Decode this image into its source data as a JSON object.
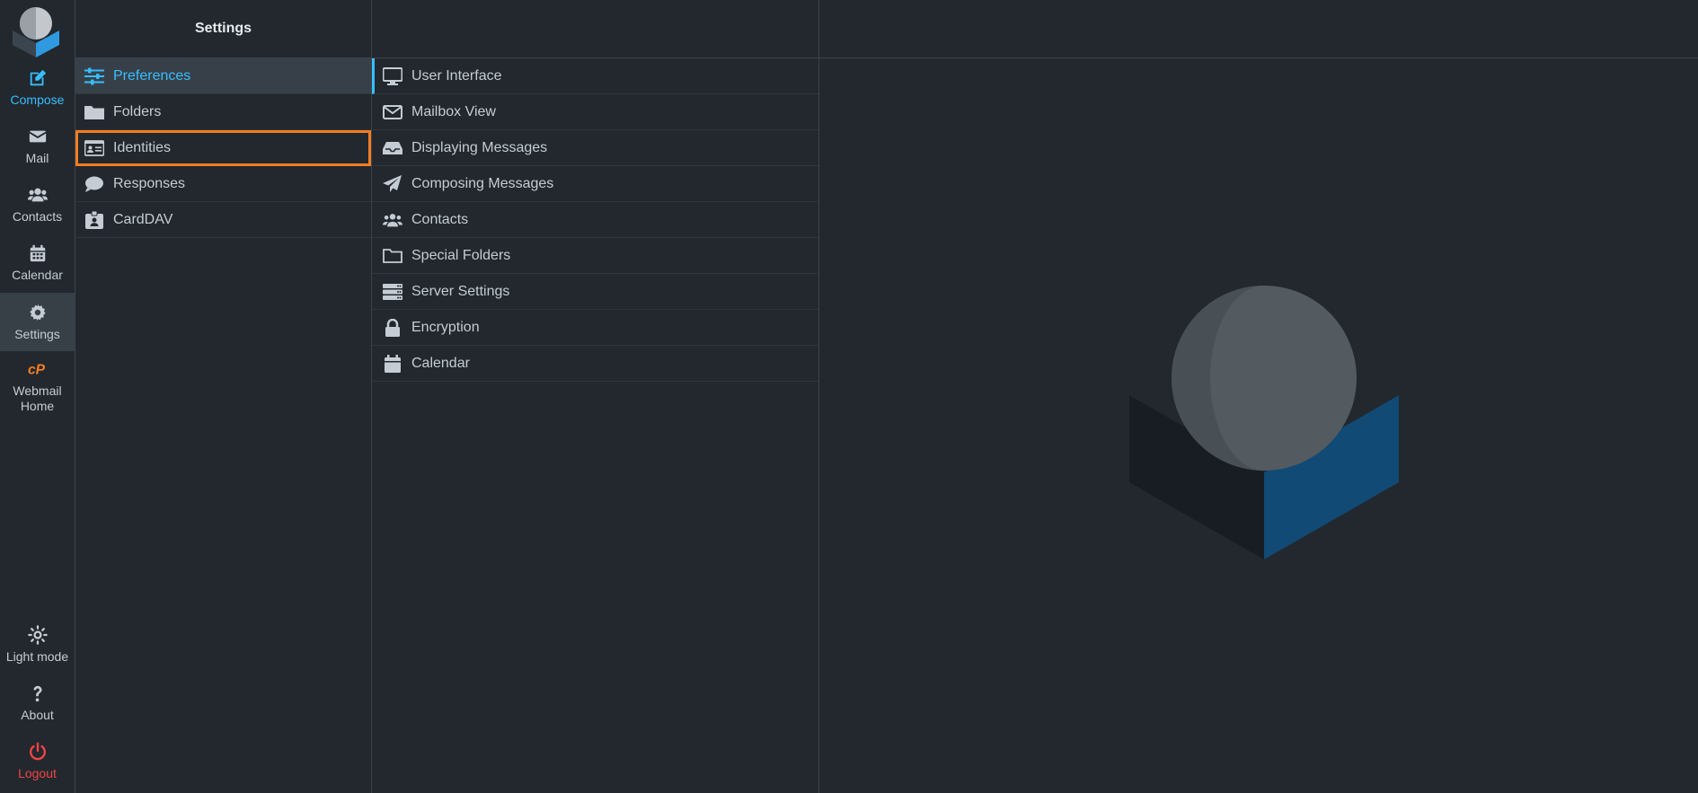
{
  "nav": {
    "compose": "Compose",
    "mail": "Mail",
    "contacts": "Contacts",
    "calendar": "Calendar",
    "settings": "Settings",
    "webmail_home_line1": "Webmail",
    "webmail_home_line2": "Home",
    "light_mode": "Light mode",
    "about": "About",
    "logout": "Logout"
  },
  "settings": {
    "title": "Settings",
    "items": [
      {
        "label": "Preferences",
        "icon": "sliders-icon"
      },
      {
        "label": "Folders",
        "icon": "folder-icon"
      },
      {
        "label": "Identities",
        "icon": "id-card-icon"
      },
      {
        "label": "Responses",
        "icon": "comment-icon"
      },
      {
        "label": "CardDAV",
        "icon": "contact-badge-icon"
      }
    ]
  },
  "sections": {
    "items": [
      {
        "label": "User Interface",
        "icon": "monitor-icon"
      },
      {
        "label": "Mailbox View",
        "icon": "envelope-icon"
      },
      {
        "label": "Displaying Messages",
        "icon": "inbox-icon"
      },
      {
        "label": "Composing Messages",
        "icon": "paper-plane-icon"
      },
      {
        "label": "Contacts",
        "icon": "users-icon"
      },
      {
        "label": "Special Folders",
        "icon": "folder-outline-icon"
      },
      {
        "label": "Server Settings",
        "icon": "server-icon"
      },
      {
        "label": "Encryption",
        "icon": "lock-icon"
      },
      {
        "label": "Calendar",
        "icon": "calendar-icon"
      }
    ]
  },
  "colors": {
    "accent": "#37beff",
    "highlight": "#f47d22",
    "logout": "#f14444",
    "background": "#22282e"
  }
}
